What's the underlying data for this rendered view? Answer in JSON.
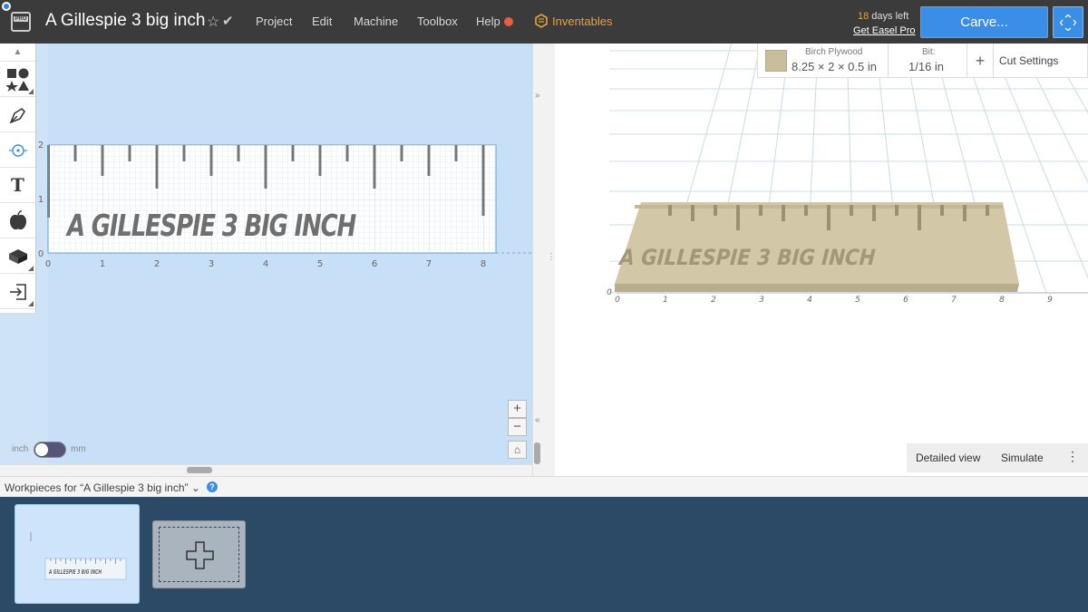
{
  "app": {
    "logo_badge": "PRO",
    "project_title": "A Gillespie 3 big inch"
  },
  "menu": {
    "project": "Project",
    "edit": "Edit",
    "machine": "Machine",
    "toolbox": "Toolbox",
    "help": "Help",
    "inventables": "Inventables"
  },
  "trial": {
    "days_num": "18",
    "days_suffix": " days left",
    "get_pro": "Get Easel Pro"
  },
  "actions": {
    "carve": "Carve..."
  },
  "toolbar": {
    "tools": [
      {
        "icon": "shapes-icon"
      },
      {
        "icon": "pen-icon"
      },
      {
        "icon": "point-icon"
      },
      {
        "icon": "text-icon",
        "glyph": "T"
      },
      {
        "icon": "apple-icon"
      },
      {
        "icon": "apps-icon"
      },
      {
        "icon": "import-icon"
      }
    ]
  },
  "design": {
    "text": "A GILLESPIE 3 BIG INCH",
    "x_ticks": [
      "0",
      "1",
      "2",
      "3",
      "4",
      "5",
      "6",
      "7",
      "8"
    ],
    "y_ticks": [
      "0",
      "1",
      "2"
    ]
  },
  "units": {
    "inch": "inch",
    "mm": "mm",
    "selected": "inch"
  },
  "material": {
    "name": "Birch Plywood",
    "dims": "8.25 × 2 × 0.5 in",
    "color": "#c9bd9b"
  },
  "bit": {
    "label": "Bit:",
    "value": "1/16 in"
  },
  "cut_settings": "Cut Settings",
  "preview3d": {
    "x_ticks": [
      "0",
      "1",
      "2",
      "3",
      "4",
      "5",
      "6",
      "7",
      "8",
      "9"
    ],
    "y_ticks": [
      "0"
    ]
  },
  "view": {
    "detailed": "Detailed view",
    "simulate": "Simulate"
  },
  "workpieces": {
    "title": "Workpieces for “A Gillespie 3 big inch”",
    "thumb_text": "A GILLESPIE 3 BIG INCH"
  },
  "colors": {
    "accent": "#3a8ee6",
    "topbar": "#3b3b3b",
    "inventables": "#e3a23a",
    "workpiece_bg": "#2c4a66"
  }
}
